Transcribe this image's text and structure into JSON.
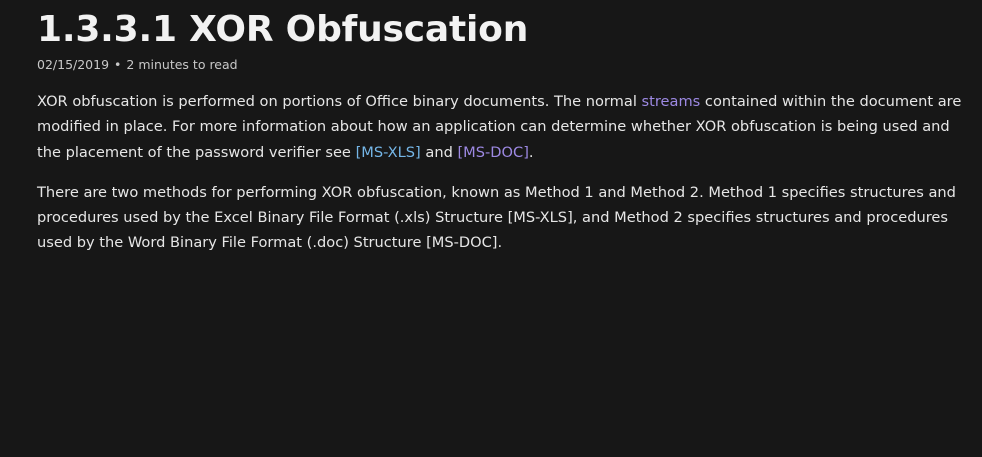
{
  "article": {
    "title": "1.3.3.1 XOR Obfuscation",
    "date": "02/15/2019",
    "separator": "•",
    "read_time": "2 minutes to read",
    "para1": {
      "t1": "XOR obfuscation is performed on portions of Office binary documents. The normal ",
      "link_streams": "streams",
      "t2": " contained within the document are modified in place. For more information about how an application can determine whether XOR obfuscation is being used and the placement of the password verifier see ",
      "link_msxls": "[MS-XLS]",
      "t3": " and ",
      "link_msdoc": "[MS-DOC]",
      "t4": "."
    },
    "para2": "There are two methods for performing XOR obfuscation, known as Method 1 and Method 2. Method 1 specifies structures and procedures used by the Excel Binary File Format (.xls) Structure [MS-XLS], and Method 2 specifies structures and procedures used by the Word Binary File Format (.doc) Structure [MS-DOC]."
  },
  "colors": {
    "background": "#171717",
    "text": "#e6e6e6",
    "link_visited": "#9d89e3",
    "link": "#75b6e7"
  }
}
